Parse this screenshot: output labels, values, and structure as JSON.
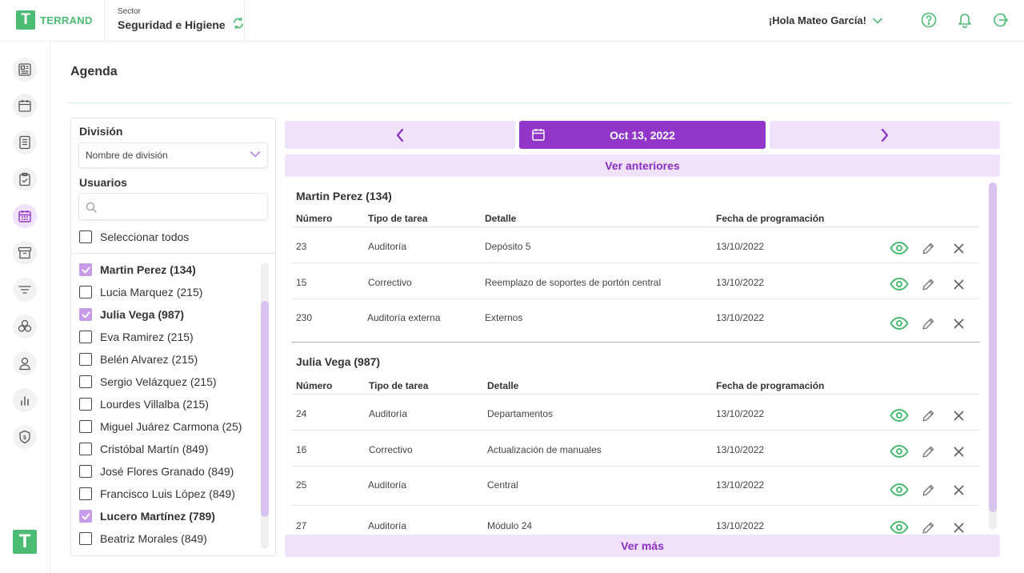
{
  "header": {
    "brand": "TERRAND",
    "brand_mark": "T",
    "sector_label": "Sector",
    "sector_name": "Seguridad e Higiene",
    "greeting": "¡Hola Mateo García!",
    "icons": [
      "help-icon",
      "bell-icon",
      "logout-icon"
    ]
  },
  "sidebar": {
    "items": [
      "dashboard-icon",
      "calendar-icon",
      "document-list-icon",
      "clipboard-check-icon",
      "agenda-icon",
      "archive-icon",
      "filter-icon",
      "groups-icon",
      "user-icon",
      "chart-icon",
      "shield-icon"
    ],
    "active_index": 4,
    "logo_mark": "T"
  },
  "page": {
    "title": "Agenda"
  },
  "filter": {
    "division_label": "División",
    "division_value": "Nombre de división",
    "users_label": "Usuarios",
    "search_placeholder": "",
    "select_all_label": "Seleccionar todos",
    "users": [
      {
        "name": "Martin Perez (134)",
        "checked": true
      },
      {
        "name": "Lucia Marquez (215)",
        "checked": false
      },
      {
        "name": "Julia Vega (987)",
        "checked": true
      },
      {
        "name": "Eva Ramirez  (215)",
        "checked": false
      },
      {
        "name": "Belén Alvarez  (215)",
        "checked": false
      },
      {
        "name": "Sergio Velázquez  (215)",
        "checked": false
      },
      {
        "name": "Lourdes Villalba  (215)",
        "checked": false
      },
      {
        "name": "Miguel Juárez Carmona  (25)",
        "checked": false
      },
      {
        "name": "Cristóbal Martín (849)",
        "checked": false
      },
      {
        "name": "José Flores Granado (849)",
        "checked": false
      },
      {
        "name": "Francisco Luis López (849)",
        "checked": false
      },
      {
        "name": "Lucero Martínez (789)",
        "checked": true
      },
      {
        "name": "Beatriz Morales (849)",
        "checked": false
      }
    ]
  },
  "date_nav": {
    "date": "Oct 13, 2022",
    "prev_icon": "chevron-left-icon",
    "next_icon": "chevron-right-icon",
    "see_previous": "Ver anteriores",
    "see_more": "Ver más"
  },
  "schedule": {
    "columns": [
      "Número",
      "Tipo de  tarea",
      "Detalle",
      "Fecha de programación"
    ],
    "groups": [
      {
        "title": "Martin Perez (134)",
        "rows": [
          {
            "numero": "23",
            "tipo": "Auditoría",
            "detalle": "Depósito 5",
            "fecha": "13/10/2022"
          },
          {
            "numero": "15",
            "tipo": "Correctivo",
            "detalle": "Reemplazo de soportes de portón central",
            "fecha": "13/10/2022"
          },
          {
            "numero": "230",
            "tipo": "Auditoría externa",
            "detalle": "Externos",
            "fecha": "13/10/2022"
          }
        ]
      },
      {
        "title": "Julia Vega (987)",
        "rows": [
          {
            "numero": "24",
            "tipo": "Auditoría",
            "detalle": "Departamentos",
            "fecha": "13/10/2022"
          },
          {
            "numero": "16",
            "tipo": "Correctivo",
            "detalle": "Actualización de manuales",
            "fecha": "13/10/2022"
          },
          {
            "numero": "25",
            "tipo": "Auditoría",
            "detalle": "Central",
            "fecha": "13/10/2022"
          },
          {
            "numero": "27",
            "tipo": "Auditoría",
            "detalle": "Módulo 24",
            "fecha": "13/10/2022"
          }
        ]
      }
    ],
    "row_actions": [
      "eye-icon",
      "pencil-icon",
      "close-icon"
    ]
  },
  "colors": {
    "brand_green": "#4cbb73",
    "accent_purple": "#9136c8",
    "light_purple": "#f1e2fc",
    "check_purple": "#c99ae8"
  }
}
